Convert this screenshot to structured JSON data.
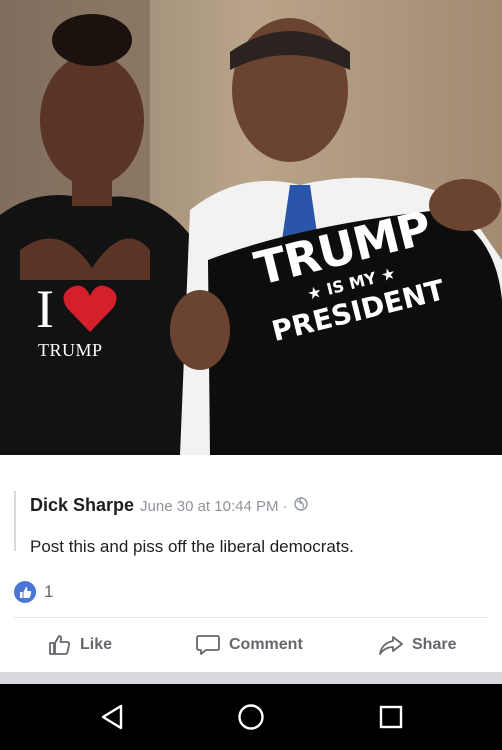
{
  "photo": {
    "shirt_left": {
      "line1": "I",
      "line2": "TRUMP"
    },
    "shirt_right": {
      "line1": "TRUMP",
      "line2": "★ IS MY ★",
      "line3": "PRESIDENT"
    }
  },
  "post": {
    "author": "Dick Sharpe",
    "timestamp": "June 30 at 10:44 PM ·",
    "text": "Post this and piss off the liberal democrats.",
    "reaction_count": "1"
  },
  "actions": {
    "like": "Like",
    "comment": "Comment",
    "share": "Share"
  },
  "colors": {
    "facebook_blue": "#4a76d8",
    "heart_red": "#d3202b",
    "secondary_text": "#65676b"
  },
  "icons": [
    "globe-icon",
    "like-reaction-icon",
    "thumbs-up-icon",
    "comment-icon",
    "share-icon",
    "back-icon",
    "home-icon",
    "recent-apps-icon"
  ]
}
